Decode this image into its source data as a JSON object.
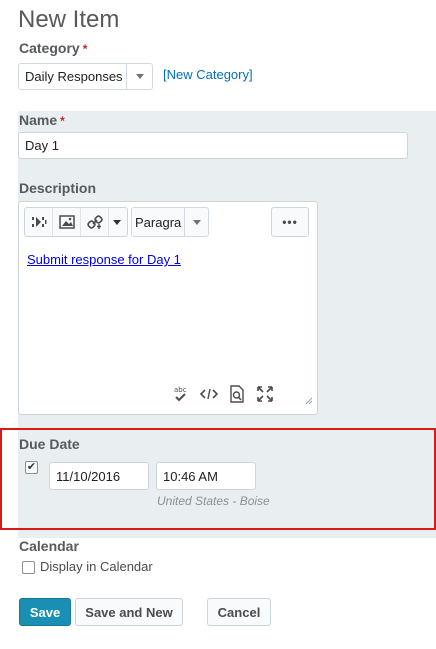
{
  "page": {
    "title": "New Item"
  },
  "category": {
    "label": "Category",
    "required_mark": "*",
    "selected": "Daily Responses",
    "new_link": "[New Category]"
  },
  "name": {
    "label": "Name",
    "required_mark": "*",
    "value": "Day 1"
  },
  "description": {
    "label": "Description",
    "toolbar": {
      "insert_stuff_icon": "insert-stuff-icon",
      "image_icon": "image-icon",
      "link_icon": "link-icon",
      "format_select": "Paragra",
      "more_label": "•••"
    },
    "content_link": "Submit response for Day 1",
    "bottom_icons": [
      "spellcheck-icon",
      "source-code-icon",
      "preview-icon",
      "fullscreen-icon"
    ]
  },
  "due_date": {
    "label": "Due Date",
    "checked": true,
    "date": "11/10/2016",
    "time": "10:46 AM",
    "timezone": "United States - Boise"
  },
  "calendar": {
    "label": "Calendar",
    "display_label": "Display in Calendar",
    "checked": false
  },
  "buttons": {
    "save": "Save",
    "save_and_new": "Save and New",
    "cancel": "Cancel"
  },
  "colors": {
    "primary": "#1b8fb3",
    "highlight_border": "#d71b1b",
    "required": "#cd2026",
    "link": "#006fbf"
  }
}
